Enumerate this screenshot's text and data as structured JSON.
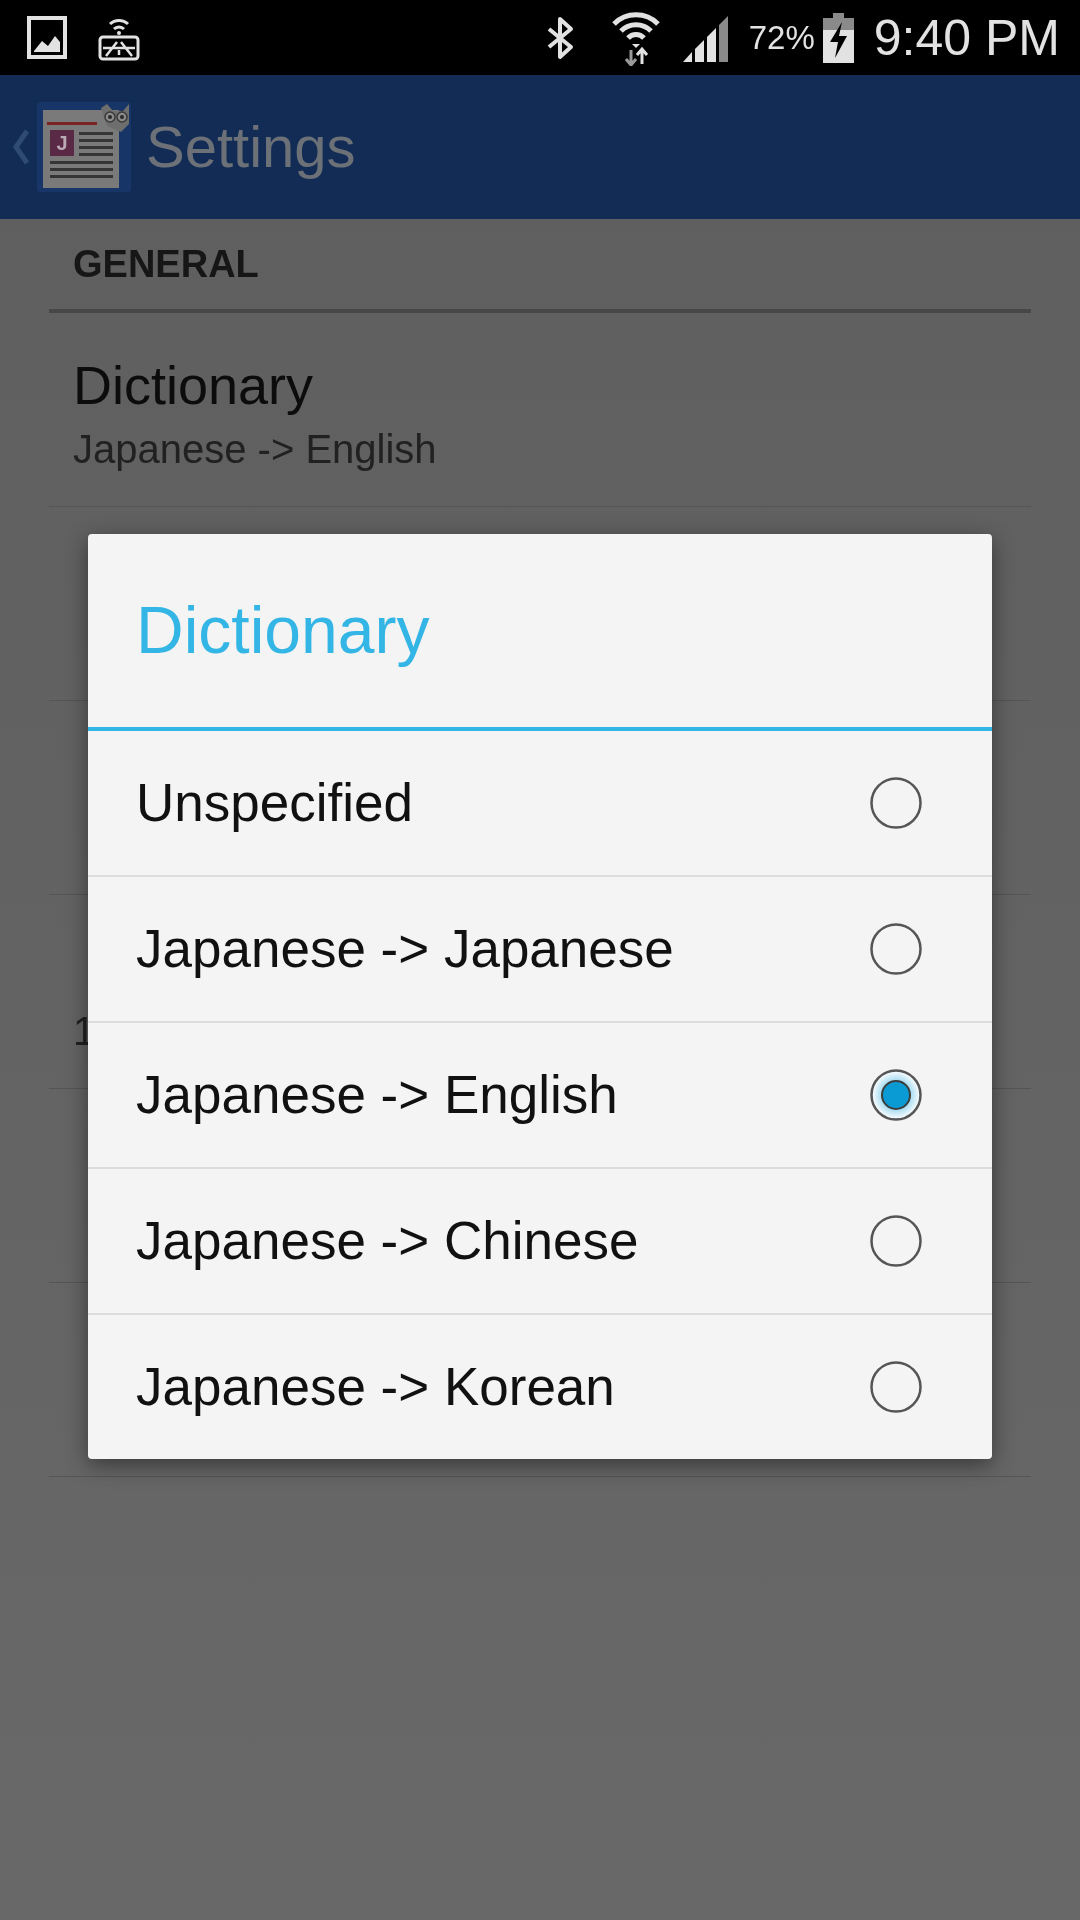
{
  "status_bar": {
    "battery": "72%",
    "time": "9:40 PM"
  },
  "app_bar": {
    "logo_letter": "J",
    "title": "Settings"
  },
  "settings": {
    "section": "GENERAL",
    "items": [
      {
        "title": "Dictionary",
        "summary": "Japanese -> English"
      },
      {
        "summary": "1"
      }
    ]
  },
  "dialog": {
    "title": "Dictionary",
    "options": [
      {
        "label": "Unspecified",
        "selected": false
      },
      {
        "label": "Japanese -> Japanese",
        "selected": false
      },
      {
        "label": "Japanese -> English",
        "selected": true
      },
      {
        "label": "Japanese -> Chinese",
        "selected": false
      },
      {
        "label": "Japanese -> Korean",
        "selected": false
      }
    ]
  }
}
